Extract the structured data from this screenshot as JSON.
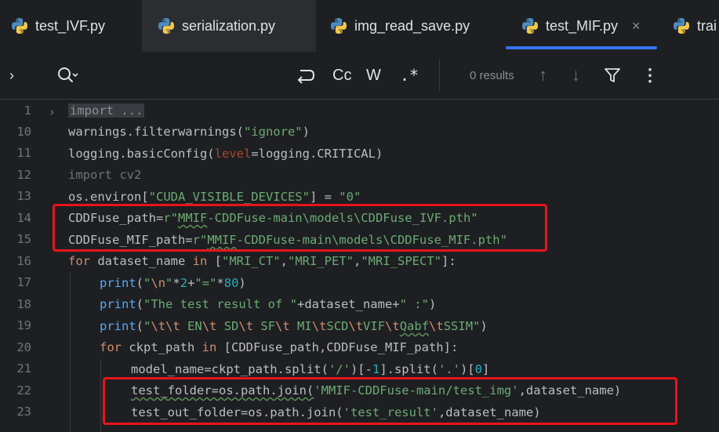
{
  "tabs": [
    {
      "label": "test_IVF.py",
      "icon": "python-icon"
    },
    {
      "label": "serialization.py",
      "icon": "python-icon"
    },
    {
      "label": "img_read_save.py",
      "icon": "python-icon"
    },
    {
      "label": "test_MIF.py",
      "icon": "python-icon",
      "active": true,
      "close": "×"
    },
    {
      "label": "trai",
      "icon": "python-icon"
    }
  ],
  "search": {
    "expand": "›",
    "options": {
      "match_case": "Cc",
      "words": "W",
      "regex": ".*"
    },
    "results": "0 results",
    "prev": "↑",
    "next": "↓",
    "more": "⋮"
  },
  "gutter": [
    "1",
    "10",
    "11",
    "12",
    "13",
    "14",
    "15",
    "16",
    "17",
    "18",
    "19",
    "20",
    "21",
    "22",
    "23"
  ],
  "code": {
    "l1_import": "import ...",
    "l10_a": "warnings.filterwarnings(",
    "l10_s": "\"ignore\"",
    "l10_b": ")",
    "l11_a": "logging.basicConfig(",
    "l11_p": "level",
    "l11_b": "=logging.CRITICAL)",
    "l12_kw": "import",
    "l12_rest": " cv2",
    "l13_a": "os.environ[",
    "l13_s1": "\"CUDA_VISIBLE_DEVICES\"",
    "l13_b": "] = ",
    "l13_s2": "\"0\"",
    "l14_a": "CDDFuse_path=",
    "l14_pre": "r\"",
    "l14_w": "MMIF",
    "l14_b": "-CDDFuse-main\\models\\CDDFuse_IVF.pth\"",
    "l15_a": "CDDFuse_MIF_path=",
    "l15_pre": "r\"",
    "l15_w": "MMIF",
    "l15_b": "-CDDFuse-main\\models\\CDDFuse_MIF.pth\"",
    "l16_kw": "for",
    "l16_a": " dataset_name ",
    "l16_in": "in",
    "l16_b": " [",
    "l16_s1": "\"MRI_CT\"",
    "l16_c1": ",",
    "l16_s2": "\"MRI_PET\"",
    "l16_c2": ",",
    "l16_s3": "\"MRI_SPECT\"",
    "l16_e": "]:",
    "l17_fn": "print",
    "l17_a": "(",
    "l17_s1": "\"",
    "l17_esc": "\\n",
    "l17_s2": "\"",
    "l17_b": "*",
    "l17_n1": "2",
    "l17_c": "+",
    "l17_s3": "\"=\"",
    "l17_d": "*",
    "l17_n2": "80",
    "l17_e": ")",
    "l18_fn": "print",
    "l18_a": "(",
    "l18_s": "\"The test result of \"",
    "l18_b": "+dataset_name+",
    "l18_s2": "\" :\"",
    "l18_e": ")",
    "l19_fn": "print",
    "l19_a": "(",
    "l19_q": "\"",
    "l19_e1": "\\t\\t",
    "l19_s1": " EN",
    "l19_e2": "\\t",
    "l19_s2": " SD",
    "l19_e3": "\\t",
    "l19_s3": " SF",
    "l19_e4": "\\t",
    "l19_s4": " MI",
    "l19_e5": "\\t",
    "l19_s5": "SCD",
    "l19_e6": "\\t",
    "l19_s6": "VIF",
    "l19_e7": "\\t",
    "l19_w": "Qabf",
    "l19_e8": "\\t",
    "l19_s7": "SSIM\"",
    "l19_end": ")",
    "l20_kw": "for",
    "l20_a": " ckpt_path ",
    "l20_in": "in",
    "l20_b": " [CDDFuse_path,CDDFuse_MIF_path]:",
    "l21_a": "model_name=ckpt_path.split(",
    "l21_s1": "'/'",
    "l21_b": ")[-",
    "l21_n1": "1",
    "l21_c": "].split(",
    "l21_s2": "'.'",
    "l21_d": ")[",
    "l21_n2": "0",
    "l21_e": "]",
    "l22_a": "test_folder=os.path.join(",
    "l22_s": "'MMIF-CDDFuse-main/test_img'",
    "l22_b": ",dataset_name)",
    "l23_a": "test_out_folder=os.path.join(",
    "l23_s": "'test_result'",
    "l23_b": ",dataset_name)"
  },
  "colors": {
    "keyword": "#cf8e6d",
    "function": "#56a8f5",
    "string": "#6aab73",
    "number": "#2aacb8",
    "annotation": "#e8141c",
    "tab_accent": "#3574f0"
  }
}
